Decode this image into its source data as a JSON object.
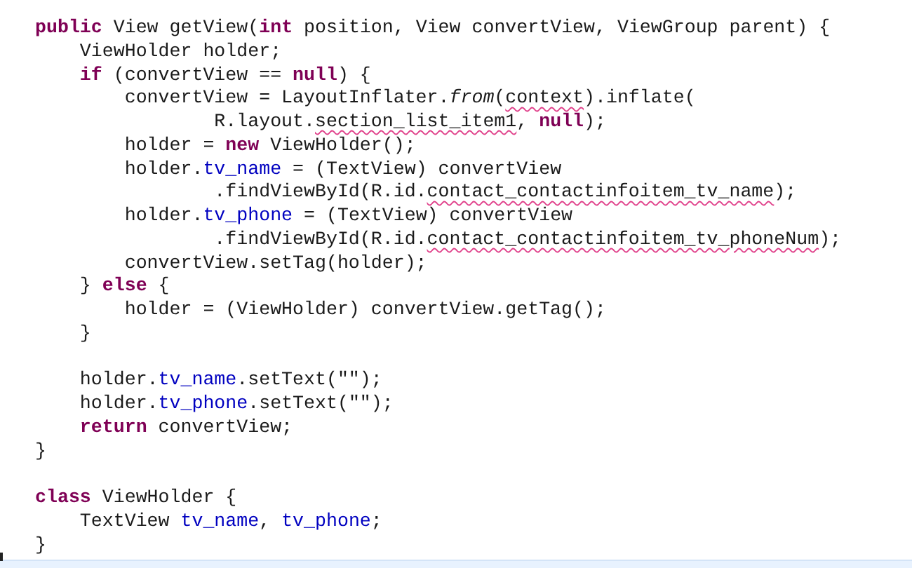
{
  "editor": {
    "blocks": [
      [
        {
          "tokens": [
            {
              "kind": "keyword",
              "text": "public"
            },
            {
              "kind": "plain",
              "text": " View getView("
            },
            {
              "kind": "keyword",
              "text": "int"
            },
            {
              "kind": "plain",
              "text": " position, View convertView, ViewGroup parent) {"
            }
          ]
        },
        {
          "tokens": [
            {
              "kind": "plain",
              "text": "    ViewHolder holder;"
            }
          ]
        },
        {
          "tokens": [
            {
              "kind": "keyword",
              "text": "    if"
            },
            {
              "kind": "plain",
              "text": " (convertView == "
            },
            {
              "kind": "keyword",
              "text": "null"
            },
            {
              "kind": "plain",
              "text": ") {"
            }
          ]
        },
        {
          "tokens": [
            {
              "kind": "plain",
              "text": "        convertView = LayoutInflater."
            },
            {
              "kind": "static",
              "text": "from"
            },
            {
              "kind": "plain",
              "text": "("
            },
            {
              "kind": "flagged",
              "text": "context"
            },
            {
              "kind": "plain",
              "text": ").inflate("
            }
          ]
        },
        {
          "tokens": [
            {
              "kind": "plain",
              "text": "                R.layout."
            },
            {
              "kind": "flagged",
              "text": "section_list_item1"
            },
            {
              "kind": "plain",
              "text": ", "
            },
            {
              "kind": "keyword",
              "text": "null"
            },
            {
              "kind": "plain",
              "text": ");"
            }
          ]
        },
        {
          "tokens": [
            {
              "kind": "plain",
              "text": "        holder = "
            },
            {
              "kind": "keyword",
              "text": "new"
            },
            {
              "kind": "plain",
              "text": " ViewHolder();"
            }
          ]
        },
        {
          "tokens": [
            {
              "kind": "plain",
              "text": "        holder."
            },
            {
              "kind": "field",
              "text": "tv_name"
            },
            {
              "kind": "plain",
              "text": " = (TextView) convertView"
            }
          ]
        },
        {
          "tokens": [
            {
              "kind": "plain",
              "text": "                .findViewById(R.id."
            },
            {
              "kind": "flagged",
              "text": "contact_contactinfoitem_tv_name"
            },
            {
              "kind": "plain",
              "text": ");"
            }
          ]
        },
        {
          "tokens": [
            {
              "kind": "plain",
              "text": "        holder."
            },
            {
              "kind": "field",
              "text": "tv_phone"
            },
            {
              "kind": "plain",
              "text": " = (TextView) convertView"
            }
          ]
        },
        {
          "tokens": [
            {
              "kind": "plain",
              "text": "                .findViewById(R.id."
            },
            {
              "kind": "flagged",
              "text": "contact_contactinfoitem_tv_phoneNum"
            },
            {
              "kind": "plain",
              "text": ");"
            }
          ]
        },
        {
          "tokens": [
            {
              "kind": "plain",
              "text": "        convertView.setTag(holder);"
            }
          ]
        },
        {
          "tokens": [
            {
              "kind": "plain",
              "text": "    } "
            },
            {
              "kind": "keyword",
              "text": "else"
            },
            {
              "kind": "plain",
              "text": " {"
            }
          ]
        },
        {
          "tokens": [
            {
              "kind": "plain",
              "text": "        holder = (ViewHolder) convertView.getTag();"
            }
          ]
        },
        {
          "tokens": [
            {
              "kind": "plain",
              "text": "    }"
            }
          ]
        }
      ],
      [
        {
          "tokens": [
            {
              "kind": "plain",
              "text": "    holder."
            },
            {
              "kind": "field",
              "text": "tv_name"
            },
            {
              "kind": "plain",
              "text": ".setText(\"\");"
            }
          ]
        },
        {
          "tokens": [
            {
              "kind": "plain",
              "text": "    holder."
            },
            {
              "kind": "field",
              "text": "tv_phone"
            },
            {
              "kind": "plain",
              "text": ".setText(\"\");"
            }
          ]
        },
        {
          "tokens": [
            {
              "kind": "keyword",
              "text": "    return"
            },
            {
              "kind": "plain",
              "text": " convertView;"
            }
          ]
        },
        {
          "tokens": [
            {
              "kind": "plain",
              "text": "}"
            }
          ]
        }
      ],
      [
        {
          "tokens": [
            {
              "kind": "keyword",
              "text": "class"
            },
            {
              "kind": "plain",
              "text": " ViewHolder {"
            }
          ]
        },
        {
          "tokens": [
            {
              "kind": "plain",
              "text": "    TextView "
            },
            {
              "kind": "field",
              "text": "tv_name"
            },
            {
              "kind": "plain",
              "text": ", "
            },
            {
              "kind": "field",
              "text": "tv_phone"
            },
            {
              "kind": "plain",
              "text": ";"
            }
          ]
        },
        {
          "tokens": [
            {
              "kind": "plain",
              "text": "}"
            }
          ]
        }
      ]
    ]
  }
}
